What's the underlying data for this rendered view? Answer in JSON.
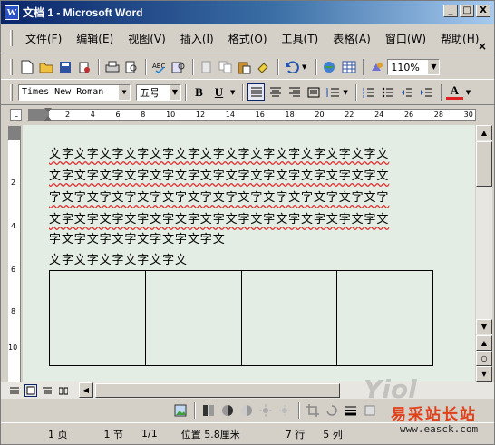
{
  "window": {
    "title": "文档 1 - Microsoft Word",
    "app_icon": "W",
    "minimize": "_",
    "restore": "□",
    "close": "X"
  },
  "menu": {
    "items": [
      "文件(F)",
      "编辑(E)",
      "视图(V)",
      "插入(I)",
      "格式(O)",
      "工具(T)",
      "表格(A)",
      "窗口(W)",
      "帮助(H)"
    ],
    "close": "×"
  },
  "toolbar": {
    "zoom": "110%"
  },
  "format": {
    "font": "Times New Roman",
    "size": "五号",
    "bold": "B",
    "underline": "U",
    "font_color": "A"
  },
  "ruler": {
    "labels": [
      "2",
      "4",
      "6",
      "8",
      "10",
      "12",
      "14",
      "16",
      "18",
      "20",
      "22",
      "24",
      "26",
      "28",
      "30"
    ],
    "vlabels": [
      "2",
      "4",
      "6",
      "8",
      "10"
    ]
  },
  "document": {
    "lines": [
      "文字文字文字文字文字文字文字文字文字文字文字文字文字文",
      "文字文字文字文字文字文字文字文字文字文字文字文字文字文",
      "字文字文字文字文字文字文字文字文字文字文字文字文字文字",
      "文字文字文字文字文字文字文字文字文字文字文字文字文字文",
      "字文字文字文字文字文字文字文",
      "文字文字文字文字文字文"
    ]
  },
  "status": {
    "page": "1 页",
    "section": "1 节",
    "count": "1/1",
    "position": "位置 5.8厘米",
    "line": "7 行",
    "col": "5 列"
  },
  "watermark": {
    "brand": "Yiol",
    "site_cn": "易采站长站",
    "url": "www.easck.com"
  }
}
